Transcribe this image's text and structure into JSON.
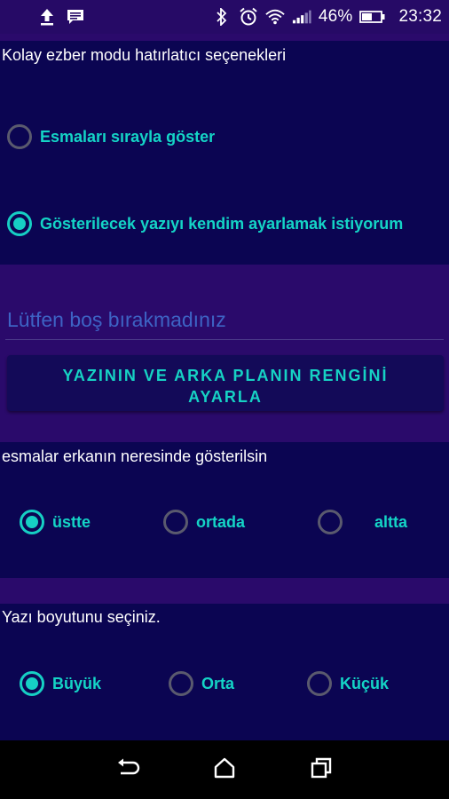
{
  "status_bar": {
    "battery": "46%",
    "time": "23:32"
  },
  "section1": {
    "title": "Kolay ezber modu hatırlatıcı seçenekleri",
    "options": [
      {
        "label": "Esmaları sırayla göster",
        "checked": false
      },
      {
        "label": "Gösterilecek yazıyı kendim ayarlamak istiyorum",
        "checked": true
      }
    ]
  },
  "text_input": {
    "placeholder": "Lütfen boş bırakmadınız"
  },
  "color_button": {
    "line1": "YAZININ VE ARKA PLANIN RENGİNİ",
    "line2": "AYARLA"
  },
  "section2": {
    "title": "esmalar erkanın neresinde gösterilsin",
    "options": [
      {
        "label": "üstte",
        "checked": true
      },
      {
        "label": "ortada",
        "checked": false
      },
      {
        "label": "altta",
        "checked": false
      }
    ]
  },
  "section3": {
    "title": "Yazı boyutunu seçiniz.",
    "options": [
      {
        "label": "Büyük",
        "checked": true
      },
      {
        "label": "Orta",
        "checked": false
      },
      {
        "label": "Küçük",
        "checked": false
      }
    ]
  },
  "colors": {
    "background": "#2a0a6b",
    "panel": "#0b0552",
    "accent": "#16cfc4",
    "hint": "#3d63c4"
  }
}
